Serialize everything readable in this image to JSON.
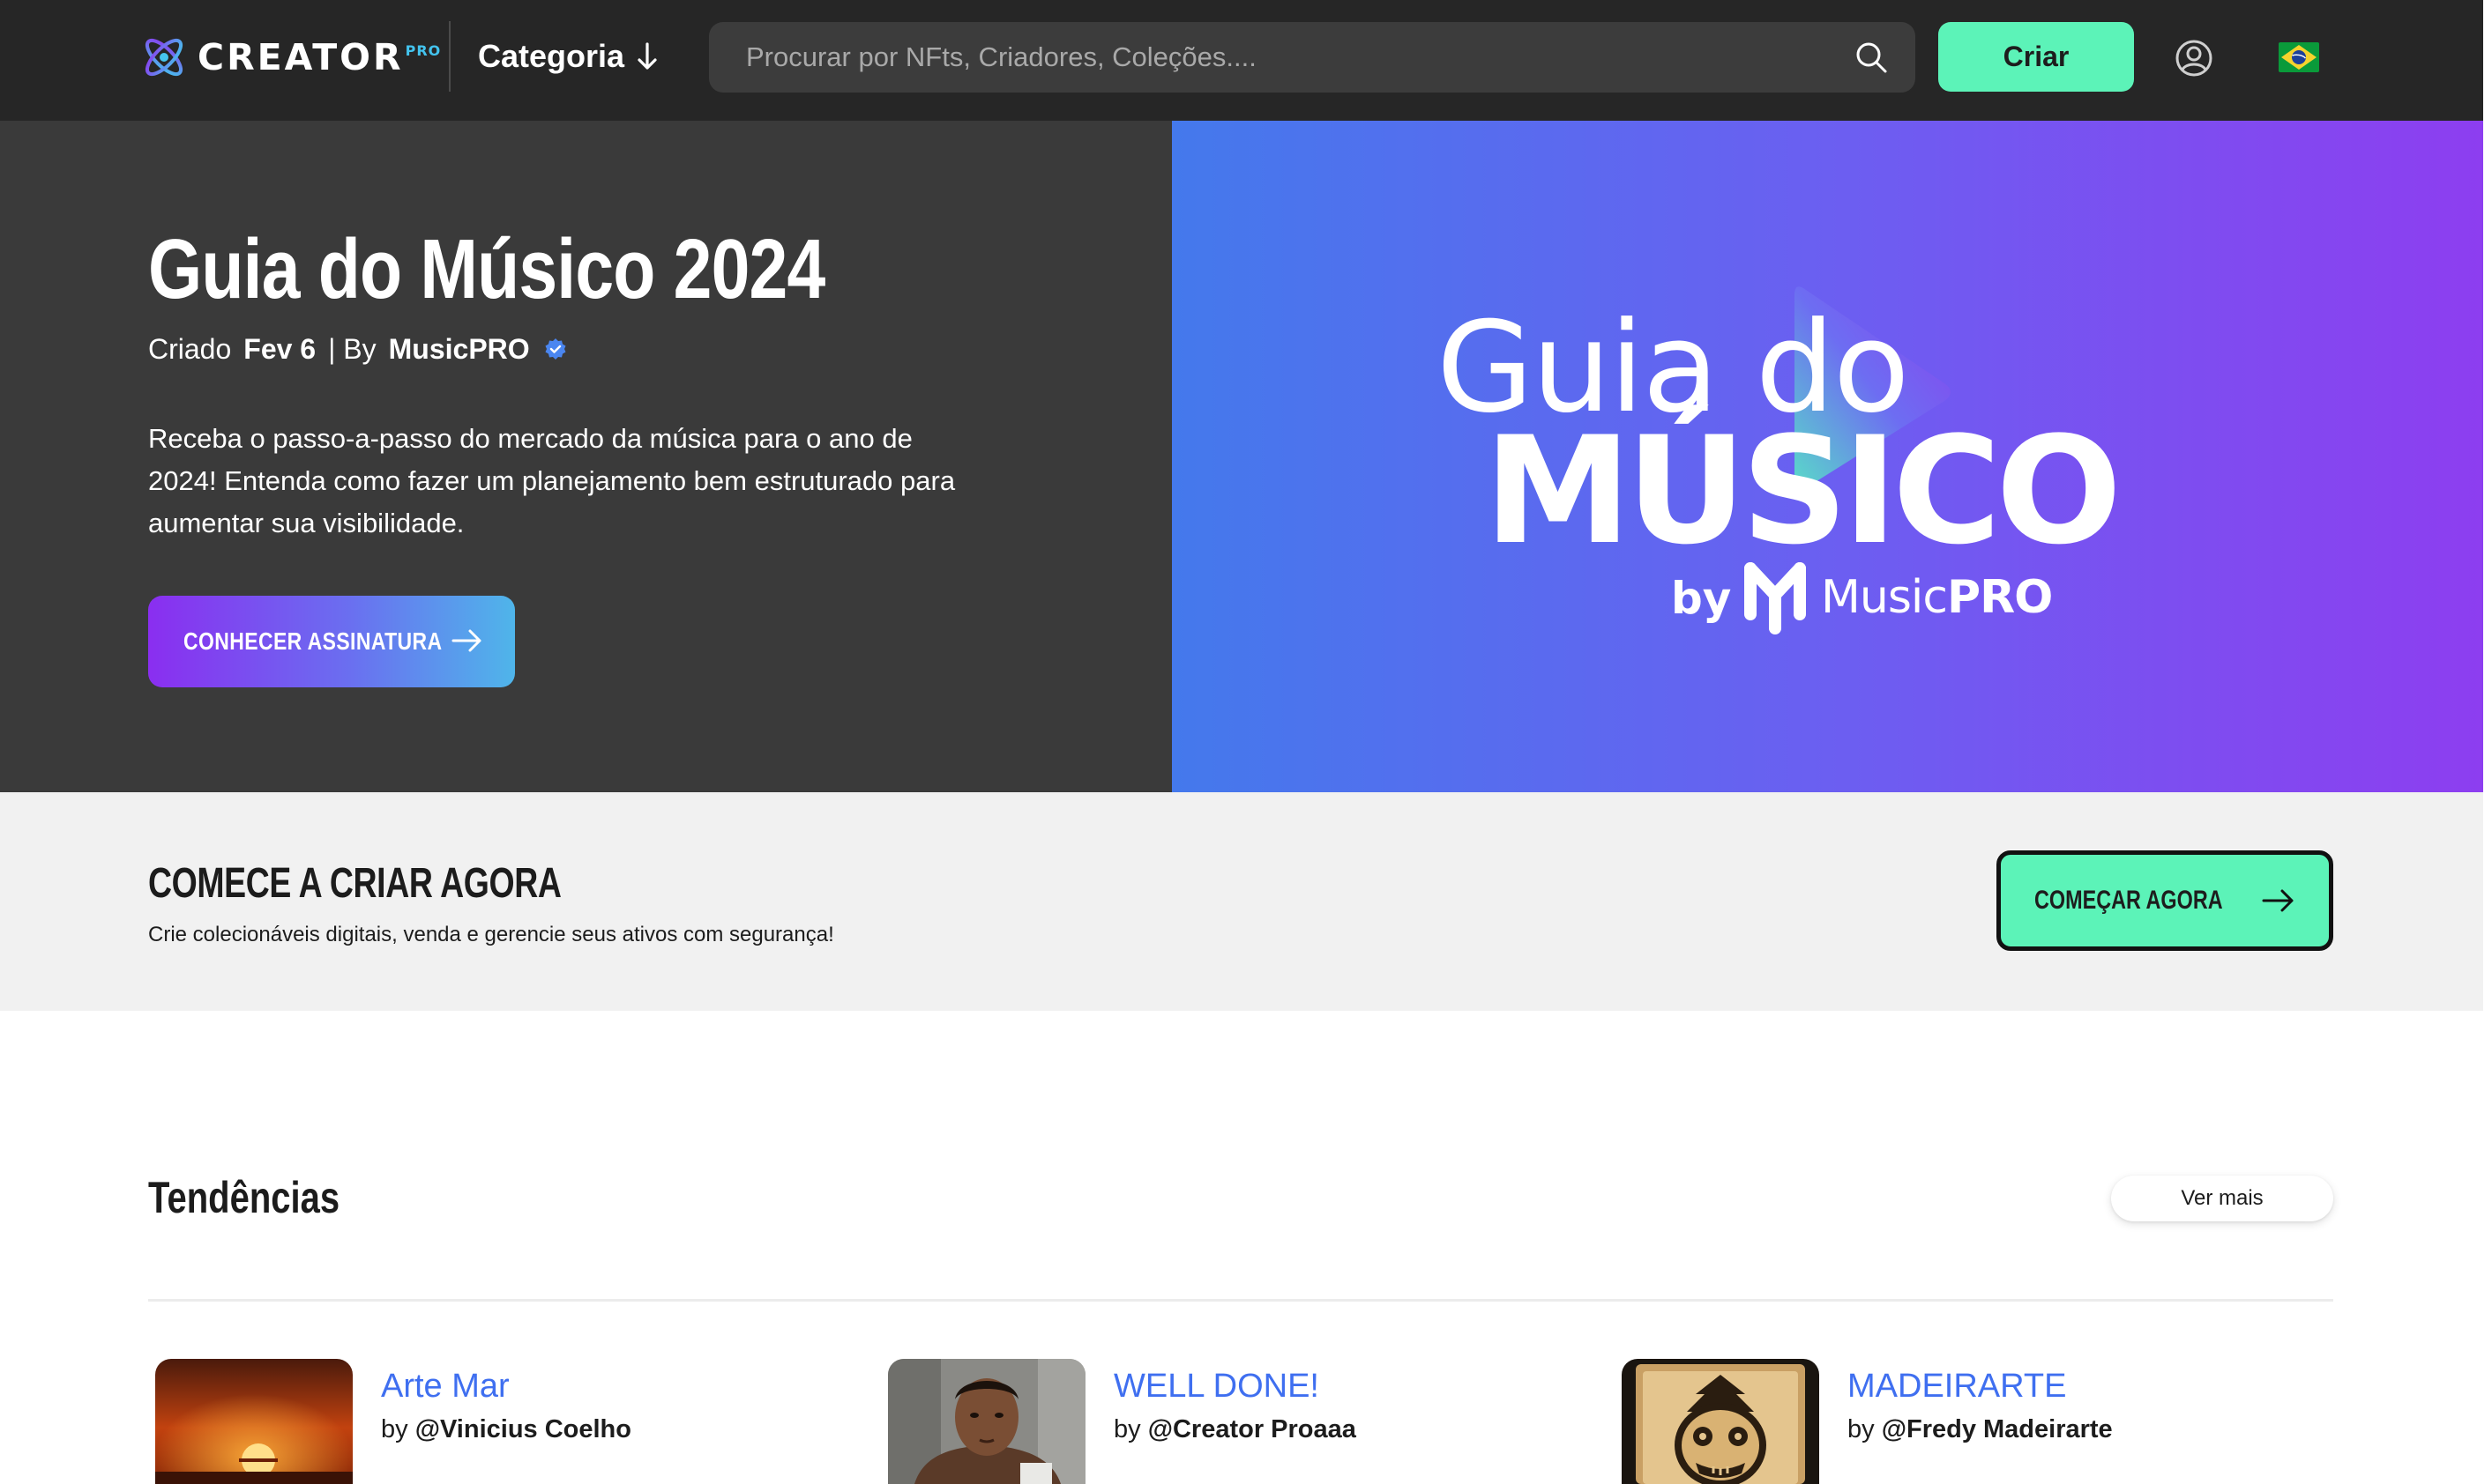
{
  "header": {
    "logo_text": "CREATOR",
    "logo_suffix": "PRO",
    "category_label": "Categoria",
    "search_placeholder": "Procurar por NFts, Criadores, Coleções....",
    "create_label": "Criar",
    "language_flag": "brazil-flag"
  },
  "hero": {
    "title": "Guia do Músico 2024",
    "created_label": "Criado",
    "date": "Fev 6",
    "by_label": "| By",
    "author": "MusicPRO",
    "description": "Receba o passo-a-passo do mercado da música para o ano de 2024! Entenda como fazer um planejamento bem estruturado para aumentar sua visibilidade.",
    "cta_label": "CONHECER ASSINATURA",
    "banner": {
      "line1": "Guia do",
      "line2": "MÚSICO",
      "by": "by",
      "brand_light": "Music",
      "brand_bold": "PRO"
    }
  },
  "cta_strip": {
    "title": "COMECE A CRIAR AGORA",
    "subtitle": "Crie colecionáveis digitais, venda e gerencie seus ativos com segurança!",
    "button_label": "COMEÇAR AGORA"
  },
  "trends": {
    "title": "Tendências",
    "see_more": "Ver mais",
    "items": [
      {
        "title": "Arte Mar",
        "by": "by",
        "author": "@Vinicius Coelho"
      },
      {
        "title": "WELL DONE!",
        "by": "by",
        "author": "@Creator Proaaa"
      },
      {
        "title": "MADEIRARTE",
        "by": "by",
        "author": "@Fredy Madeirarte"
      }
    ]
  },
  "colors": {
    "header_bg": "#262626",
    "accent_green": "#5cf3b8",
    "hero_left_bg": "#3a3a3a",
    "link_blue": "#3f6ff0",
    "banner_gradient_start": "#4479ec",
    "banner_gradient_end": "#8d3ef0"
  }
}
